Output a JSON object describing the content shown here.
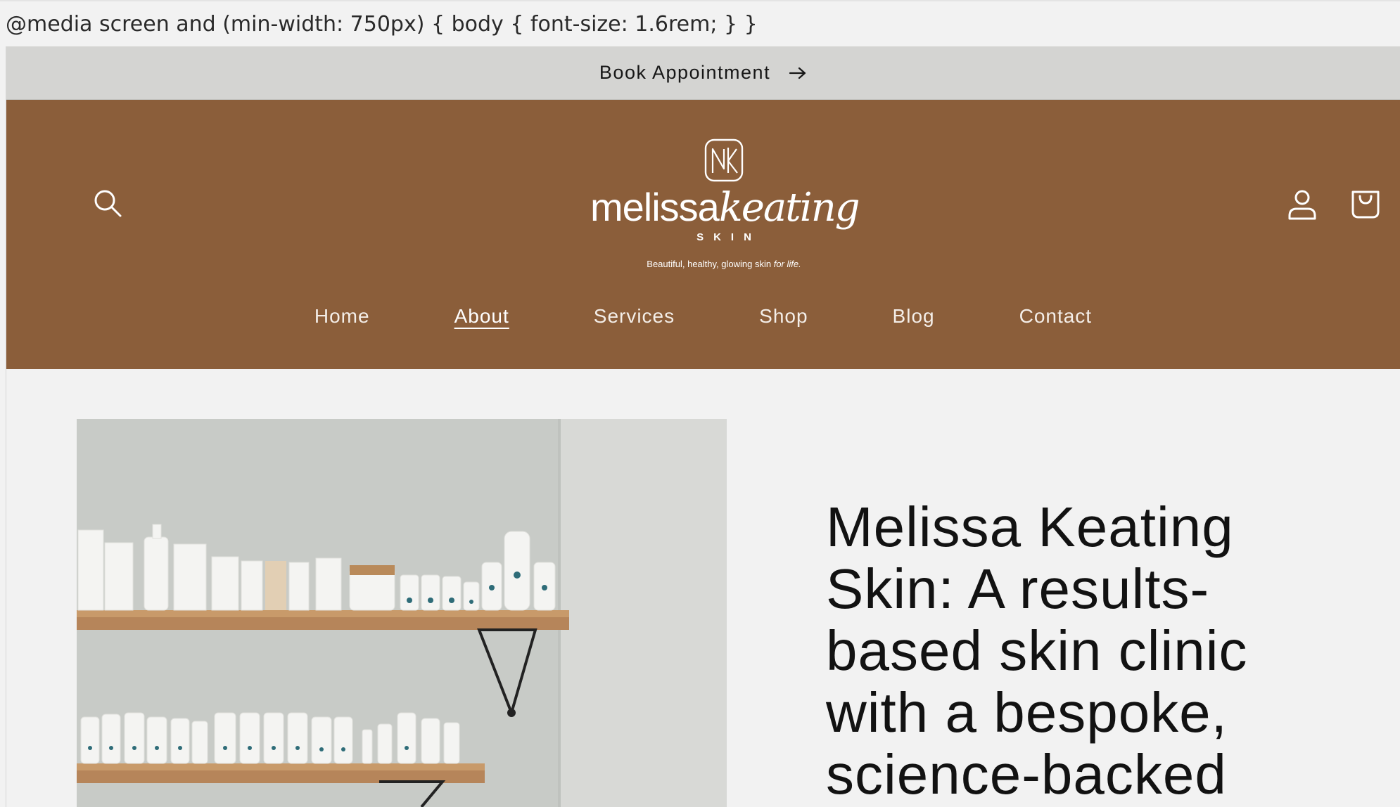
{
  "css_leak_text": "@media screen and (min-width: 750px) { body { font-size: 1.6rem; } }",
  "announcement": {
    "label": "Book Appointment",
    "icon": "arrow-right-icon"
  },
  "header": {
    "background_color": "#8b5e3a",
    "logo": {
      "monogram": "MK",
      "word_first": "melissa",
      "word_second": "keating",
      "subtitle": "SKIN",
      "tagline_main": "Beautiful, healthy, glowing skin ",
      "tagline_emphasis": "for life."
    },
    "icons": {
      "search": "search-icon",
      "account": "account-icon",
      "cart": "cart-icon"
    },
    "nav": [
      {
        "label": "Home",
        "active": false
      },
      {
        "label": "About",
        "active": true
      },
      {
        "label": "Services",
        "active": false
      },
      {
        "label": "Shop",
        "active": false
      },
      {
        "label": "Blog",
        "active": false
      },
      {
        "label": "Contact",
        "active": false
      }
    ]
  },
  "main": {
    "heading": "Melissa Keating Skin: A results-based skin clinic with a bespoke, science-backed"
  }
}
